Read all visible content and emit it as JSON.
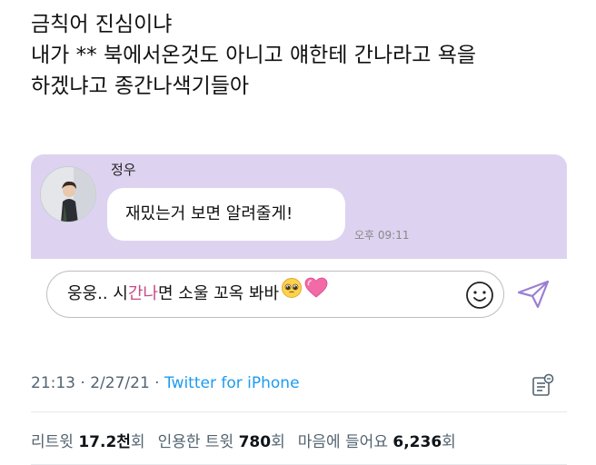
{
  "tweet": {
    "lines": [
      "금칙어 진심이냐",
      "내가 ** 북에서온것도 아니고 얘한테 간나라고 욕을",
      "하겠냐고 종간나색기들아"
    ]
  },
  "chat": {
    "sender_name": "정우",
    "message": "재밌는거 보면 알려줄게!",
    "time": "오후 09:11"
  },
  "input": {
    "text_before": "웅웅.. 시",
    "text_highlight": "간나",
    "text_after": "면 소울 꼬옥 봐바",
    "emojis": [
      "pleading-face",
      "pink-heart"
    ]
  },
  "meta": {
    "time": "21:13",
    "separator1": " · ",
    "date": "2/27/21",
    "separator2": " · ",
    "source": "Twitter for iPhone"
  },
  "stats": {
    "retweets_label": "리트윗",
    "retweets_value": "17.2천",
    "retweets_unit": "회",
    "quotes_label": "인용한 트윗",
    "quotes_value": "780",
    "quotes_unit": "회",
    "likes_label": "마음에 들어요",
    "likes_value": "6,236",
    "likes_unit": "회"
  },
  "colors": {
    "chat_bg": "#ddd3f0",
    "send_icon": "#9b7fd3",
    "highlight_text": "#c74a83",
    "link": "#1d9bf0",
    "muted": "#536471"
  }
}
